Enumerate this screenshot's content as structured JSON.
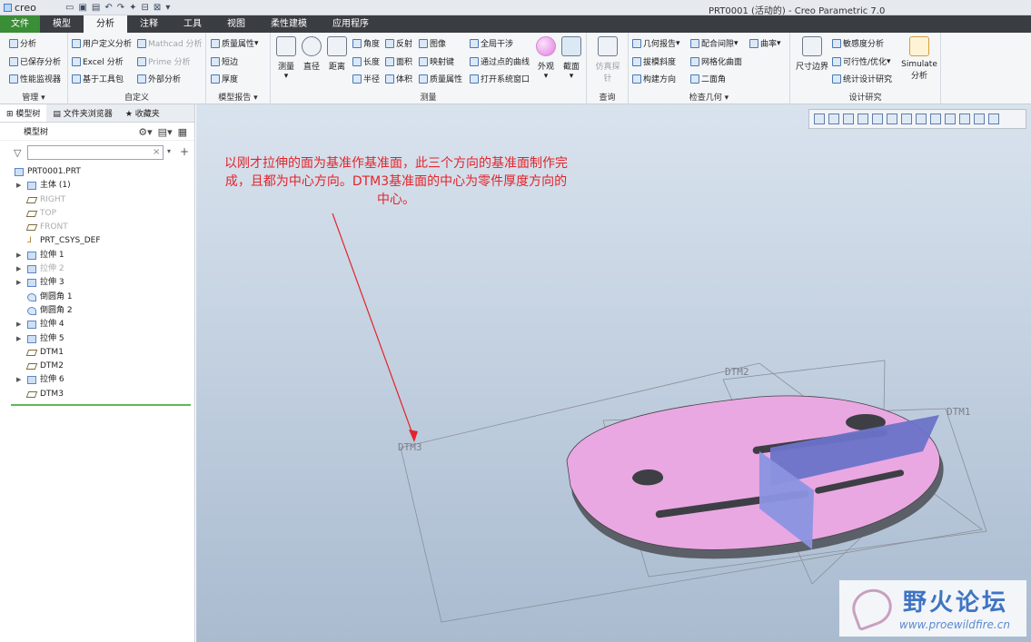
{
  "window": {
    "logo": "creo",
    "title": "PRT0001 (活动的) - Creo Parametric 7.0"
  },
  "menu_tabs": [
    "文件",
    "模型",
    "分析",
    "注释",
    "工具",
    "视图",
    "柔性建模",
    "应用程序"
  ],
  "active_tab": "分析",
  "ribbon": {
    "manage": {
      "label": "管理",
      "items": [
        "分析",
        "已保存分析",
        "性能监视器"
      ]
    },
    "custom": {
      "label": "自定义",
      "items": [
        "用户定义分析",
        "Excel 分析",
        "基于工具包",
        "Mathcad 分析",
        "Prime 分析",
        "外部分析"
      ]
    },
    "model_report": {
      "label": "模型报告",
      "items": [
        "质量属性",
        "短边",
        "厚度"
      ]
    },
    "measure": {
      "label": "测量",
      "big": [
        "测量",
        "直径",
        "距离"
      ],
      "items": [
        "角度",
        "反射",
        "图像",
        "全局干涉",
        "长度",
        "面积",
        "映射键",
        "通过点的曲线",
        "半径",
        "体积",
        "质量属性",
        "打开系统窗口"
      ],
      "big2": [
        "外观",
        "截面"
      ]
    },
    "inspect": {
      "label": "查询",
      "big": [
        "仿真探针"
      ]
    },
    "geometry": {
      "label": "检查几何",
      "items": [
        "几何报告",
        "配合间隙",
        "曲率",
        "拔模斜度",
        "网格化曲面",
        "构建方向",
        "二面角"
      ]
    },
    "design_study": {
      "label": "设计研究",
      "big": [
        "尺寸边界",
        "Simulate 分析"
      ],
      "items": [
        "敏感度分析",
        "可行性/优化",
        "统计设计研究"
      ]
    }
  },
  "sidebar": {
    "tabs": [
      "模型树",
      "文件夹浏览器",
      "收藏夹"
    ],
    "header": "模型树",
    "tree": [
      {
        "label": "PRT0001.PRT",
        "type": "part",
        "arrow": false,
        "dim": false
      },
      {
        "label": "主体 (1)",
        "type": "body",
        "arrow": true,
        "dim": false
      },
      {
        "label": "RIGHT",
        "type": "plane",
        "arrow": false,
        "dim": true
      },
      {
        "label": "TOP",
        "type": "plane",
        "arrow": false,
        "dim": true
      },
      {
        "label": "FRONT",
        "type": "plane",
        "arrow": false,
        "dim": true
      },
      {
        "label": "PRT_CSYS_DEF",
        "type": "csys",
        "arrow": false,
        "dim": false
      },
      {
        "label": "拉伸 1",
        "type": "extrude",
        "arrow": true,
        "dim": false
      },
      {
        "label": "拉伸 2",
        "type": "extrude",
        "arrow": true,
        "dim": true
      },
      {
        "label": "拉伸 3",
        "type": "extrude",
        "arrow": true,
        "dim": false
      },
      {
        "label": "倒圆角 1",
        "type": "round",
        "arrow": false,
        "dim": false
      },
      {
        "label": "倒圆角 2",
        "type": "round",
        "arrow": false,
        "dim": false
      },
      {
        "label": "拉伸 4",
        "type": "extrude",
        "arrow": true,
        "dim": false
      },
      {
        "label": "拉伸 5",
        "type": "extrude",
        "arrow": true,
        "dim": false
      },
      {
        "label": "DTM1",
        "type": "plane",
        "arrow": false,
        "dim": false
      },
      {
        "label": "DTM2",
        "type": "plane",
        "arrow": false,
        "dim": false
      },
      {
        "label": "拉伸 6",
        "type": "extrude",
        "arrow": true,
        "dim": false
      },
      {
        "label": "DTM3",
        "type": "plane",
        "arrow": false,
        "dim": false
      }
    ]
  },
  "viewport": {
    "annotation": "以刚才拉伸的面为基准作基准面，此三个方向的基准面制作完成，且都为中心方向。DTM3基准面的中心为零件厚度方向的中心。",
    "datum_labels": {
      "dtm1": "DTM1",
      "dtm2": "DTM2",
      "dtm3": "DTM3"
    },
    "colors": {
      "part": "#e9a8e2",
      "plane": "#6b73c8",
      "annotation": "#e3242b"
    }
  },
  "watermark": {
    "title": "野火论坛",
    "url": "www.proewildfire.cn"
  }
}
